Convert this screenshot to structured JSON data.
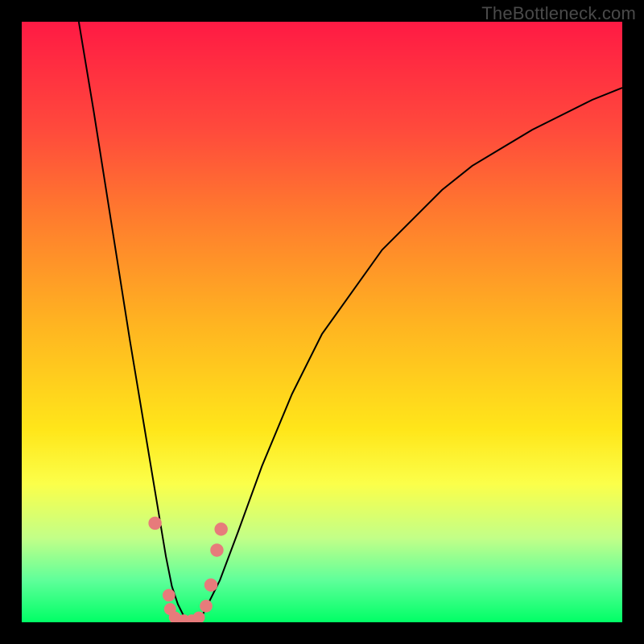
{
  "watermark": {
    "text": "TheBottleneck.com"
  },
  "chart_data": {
    "type": "line",
    "title": "",
    "xlabel": "",
    "ylabel": "",
    "xlim": [
      0,
      100
    ],
    "ylim": [
      0,
      100
    ],
    "grid": false,
    "annotations": [],
    "series": [
      {
        "name": "bottleneck-curve",
        "x": [
          9.5,
          12,
          15,
          18,
          20,
          22,
          23,
          24,
          25,
          26,
          27,
          28,
          29,
          30,
          31,
          33,
          36,
          40,
          45,
          50,
          55,
          60,
          65,
          70,
          75,
          80,
          85,
          90,
          95,
          100
        ],
        "y": [
          100,
          85,
          66,
          47,
          35,
          23,
          17,
          11,
          6,
          3,
          1,
          0,
          0,
          1,
          3,
          7,
          15,
          26,
          38,
          48,
          55,
          62,
          67,
          72,
          76,
          79,
          82,
          84.5,
          87,
          89
        ]
      }
    ],
    "markers": [
      {
        "x": 22.2,
        "y": 16.5,
        "r": 1.1
      },
      {
        "x": 24.5,
        "y": 4.5,
        "r": 1.05
      },
      {
        "x": 24.7,
        "y": 2.2,
        "r": 1.0
      },
      {
        "x": 25.5,
        "y": 0.8,
        "r": 1.0
      },
      {
        "x": 27.0,
        "y": 0.3,
        "r": 1.0
      },
      {
        "x": 28.3,
        "y": 0.3,
        "r": 1.0
      },
      {
        "x": 29.5,
        "y": 0.8,
        "r": 1.0
      },
      {
        "x": 30.7,
        "y": 2.7,
        "r": 1.05
      },
      {
        "x": 31.5,
        "y": 6.2,
        "r": 1.1
      },
      {
        "x": 32.5,
        "y": 12.0,
        "r": 1.1
      },
      {
        "x": 33.2,
        "y": 15.5,
        "r": 1.1
      }
    ],
    "marker_color": "#e77b7b",
    "curve_color": "#000000",
    "curve_width": 2
  }
}
